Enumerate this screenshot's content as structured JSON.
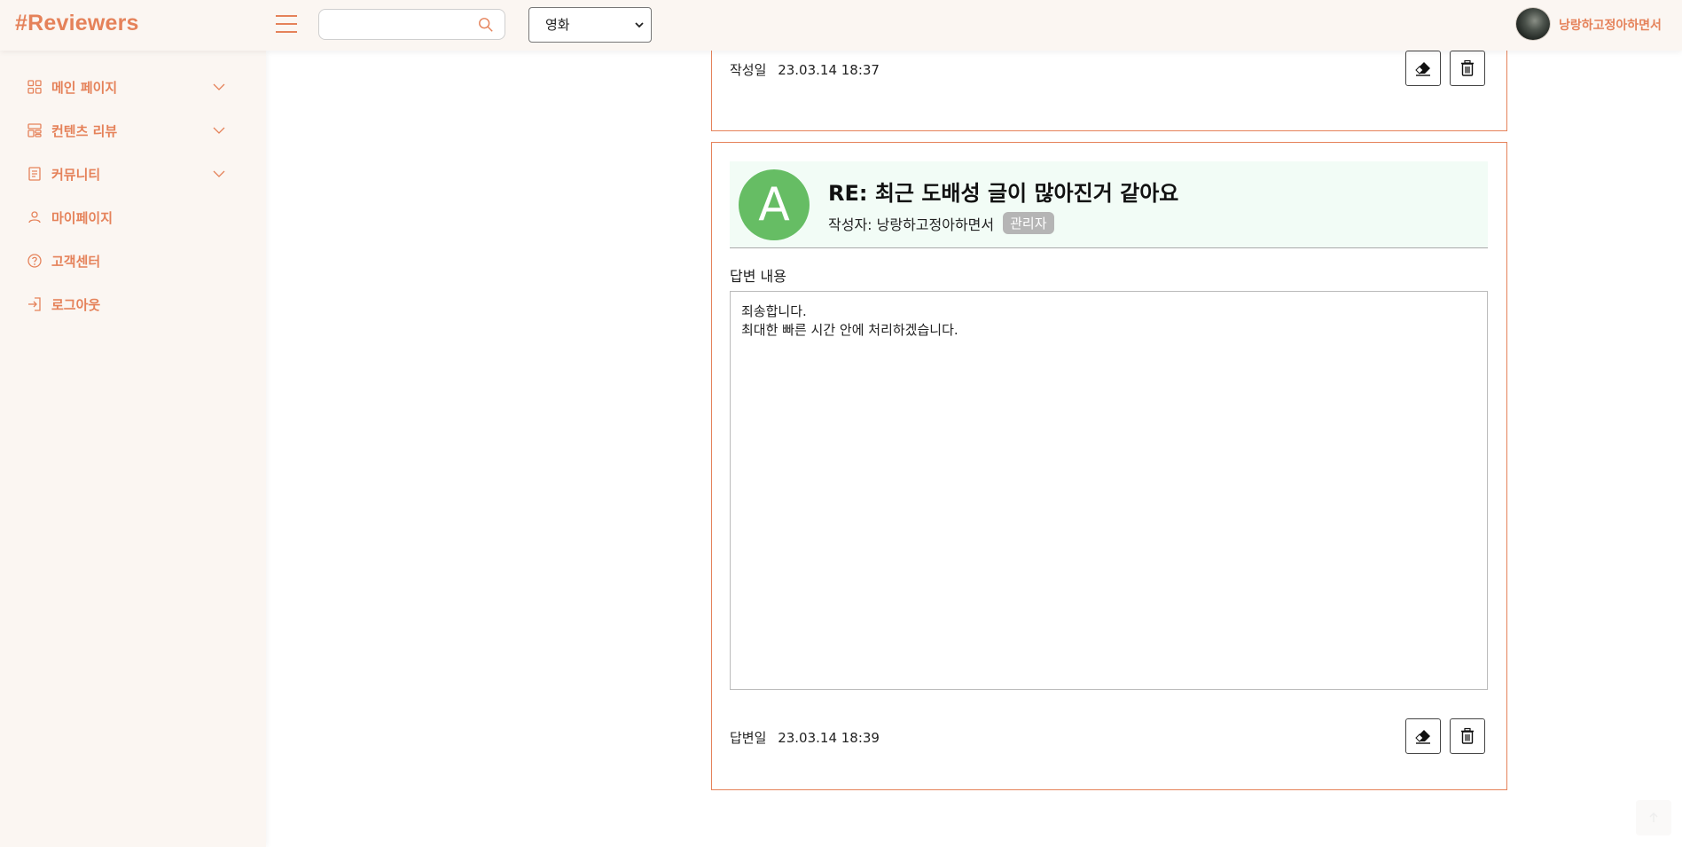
{
  "header": {
    "logo": "#Reviewers",
    "search": {
      "value": "",
      "placeholder": ""
    },
    "category": {
      "selected": "영화"
    },
    "user": {
      "name": "낭랑하고정아하면서"
    }
  },
  "sidebar": {
    "items": [
      {
        "label": "메인 페이지",
        "icon": "grid-icon",
        "expandable": true
      },
      {
        "label": "컨텐츠 리뷰",
        "icon": "layout-icon",
        "expandable": true
      },
      {
        "label": "커뮤니티",
        "icon": "document-icon",
        "expandable": true
      },
      {
        "label": "마이페이지",
        "icon": "person-icon",
        "expandable": false
      },
      {
        "label": "고객센터",
        "icon": "help-circle-icon",
        "expandable": false
      },
      {
        "label": "로그아웃",
        "icon": "logout-icon",
        "expandable": false
      }
    ]
  },
  "post": {
    "date_label": "작성일",
    "date_value": "23.03.14 18:37"
  },
  "reply": {
    "avatar_letter": "A",
    "title": "RE: 최근 도배성 글이 많아진거 같아요",
    "author_label": "작성자: 낭랑하고정아하면서",
    "badge": "관리자",
    "content_label": "답변 내용",
    "content_line1": "죄송합니다.",
    "content_line2": "최대한 빠른 시간 안에 처리하겠습니다.",
    "date_label": "답변일",
    "date_value": "23.03.14 18:39"
  },
  "colors": {
    "accent": "#e5825a",
    "sidebar_bg": "#fbf6f2",
    "avatar_green": "#66bd64",
    "reply_header_bg": "#f2fcf6",
    "badge_bg": "#b5b5b5"
  }
}
